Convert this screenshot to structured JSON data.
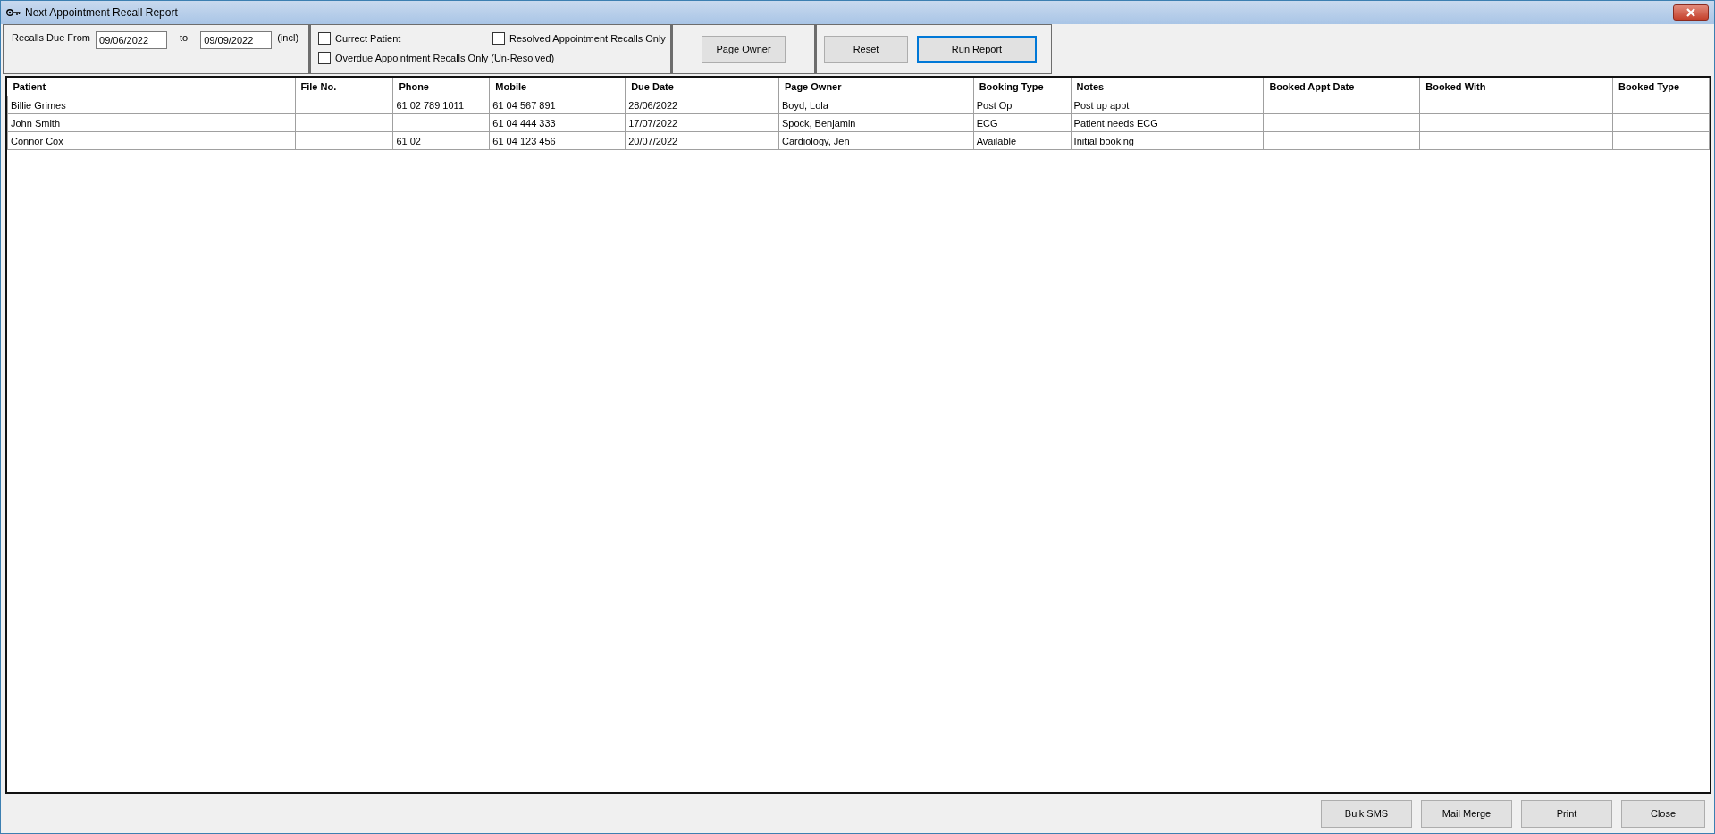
{
  "window": {
    "title": "Next Appointment Recall Report"
  },
  "filter": {
    "from_label": "Recalls Due From",
    "from_value": "09/06/2022",
    "to_label": "to",
    "to_value": "09/09/2022",
    "incl_label": "(incl)"
  },
  "checkboxes": [
    {
      "label": "Currect Patient",
      "checked": false
    },
    {
      "label": "Resolved Appointment Recalls Only",
      "checked": false
    },
    {
      "label": "Overdue Appointment Recalls Only (Un-Resolved)",
      "checked": false
    }
  ],
  "owner_button": {
    "label": "Page Owner",
    "focused": false
  },
  "action_buttons": [
    {
      "label": "Reset",
      "focused": false
    },
    {
      "label": "Run Report",
      "focused": true
    }
  ],
  "table": {
    "columns": [
      "Patient",
      "File No.",
      "Phone",
      "Mobile",
      "Due Date",
      "Page Owner",
      "Booking Type",
      "Notes",
      "Booked Appt Date",
      "Booked With",
      "Booked Type"
    ],
    "rows": [
      [
        "Billie Grimes",
        "",
        "61 02 789 1011",
        "61  04 567 891",
        "28/06/2022",
        "Boyd, Lola",
        "Post Op",
        "Post up appt",
        "",
        "",
        ""
      ],
      [
        "John Smith",
        "",
        "",
        "61  04 444 333",
        "17/07/2022",
        "Spock, Benjamin",
        "ECG",
        "Patient needs ECG",
        "",
        "",
        ""
      ],
      [
        "Connor Cox",
        "",
        "61 02",
        "61  04 123 456",
        "20/07/2022",
        "Cardiology, Jen",
        "Available",
        "Initial booking",
        "",
        "",
        ""
      ]
    ]
  },
  "footer_buttons": [
    {
      "label": "Bulk SMS",
      "focused": false
    },
    {
      "label": "Mail Merge",
      "focused": false
    },
    {
      "label": "Print",
      "focused": false
    },
    {
      "label": "Close",
      "focused": false
    }
  ]
}
